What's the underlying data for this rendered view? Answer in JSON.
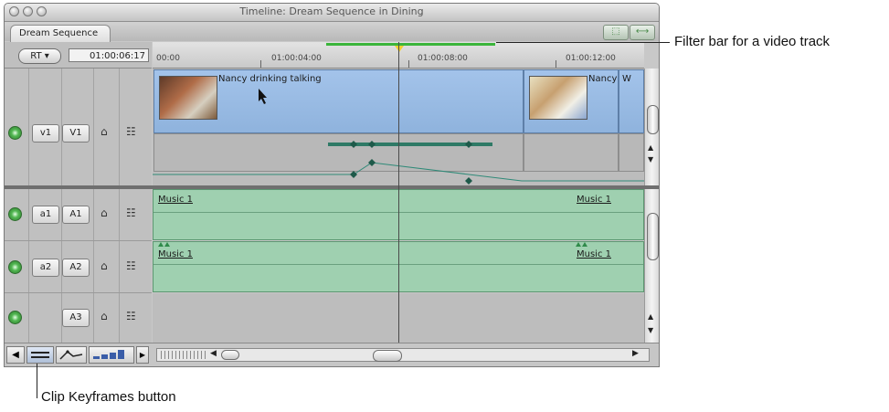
{
  "window": {
    "title": "Timeline: Dream Sequence in Dining"
  },
  "tab": {
    "label": "Dream Sequence"
  },
  "controls": {
    "rt_label": "RT ▾",
    "timecode": "01:00:06:17"
  },
  "ruler": {
    "ticks": [
      "00:00",
      "01:00:04:00",
      "01:00:08:00",
      "01:00:12:00"
    ]
  },
  "tracks": {
    "video": {
      "source": "v1",
      "dest": "V1"
    },
    "audio1": {
      "source": "a1",
      "dest": "A1"
    },
    "audio2": {
      "source": "a2",
      "dest": "A2"
    },
    "audio3": {
      "dest": "A3"
    }
  },
  "clips": {
    "video_main": "Nancy drinking talking",
    "video_second": "Nancy",
    "video_third": "W",
    "music": "Music 1"
  },
  "icons": {
    "lock": "⌂",
    "monitor": "☷",
    "play": "▶",
    "left_arrow": "◀",
    "right_arrow": "▶",
    "up_arrow": "▲",
    "down_arrow": "▼"
  },
  "callouts": {
    "filter_bar": "Filter bar for a video track",
    "clip_keyframes": "Clip Keyframes button"
  },
  "colors": {
    "filter_bar": "#3bb53b",
    "video_clip": "#9ab9e3",
    "audio_clip": "#9fd0b0",
    "playhead": "#f0d030"
  }
}
